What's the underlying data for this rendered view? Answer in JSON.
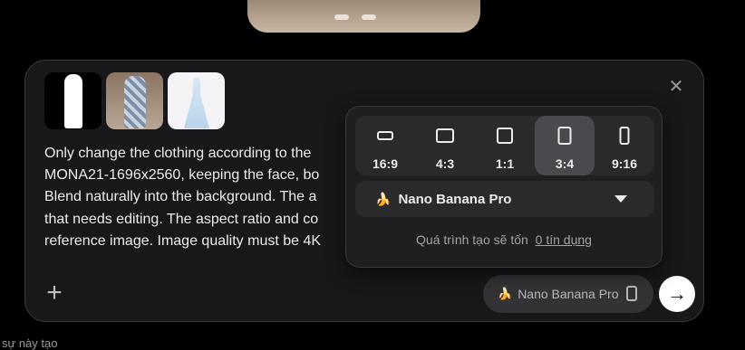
{
  "composer": {
    "prompt_text": "Only change the clothing according to the\nMONA21-1696x2560, keeping the face, bo\nBlend naturally into the background. The a\nthat needs editing. The aspect ratio and co\nreference image. Image quality must be 4K",
    "close_icon": "close-icon",
    "add_icon": "plus-icon",
    "model_chip_label": "Nano Banana Pro",
    "send_icon": "arrow-right-icon"
  },
  "settings_panel": {
    "aspect_ratios": [
      {
        "label": "16:9",
        "selected": false
      },
      {
        "label": "4:3",
        "selected": false
      },
      {
        "label": "1:1",
        "selected": false
      },
      {
        "label": "3:4",
        "selected": true
      },
      {
        "label": "9:16",
        "selected": false
      }
    ],
    "model_name": "Nano Banana Pro",
    "cost_text": "Quá trình tạo sẽ tốn",
    "cost_link": "0 tín dụng"
  },
  "bottom_text": "sự này tạo",
  "colors": {
    "background": "#000000",
    "composer_bg": "#18181a",
    "panel_bg": "#1f1f22",
    "selected_bg": "#4a4a4e",
    "send_button": "#ffffff"
  }
}
